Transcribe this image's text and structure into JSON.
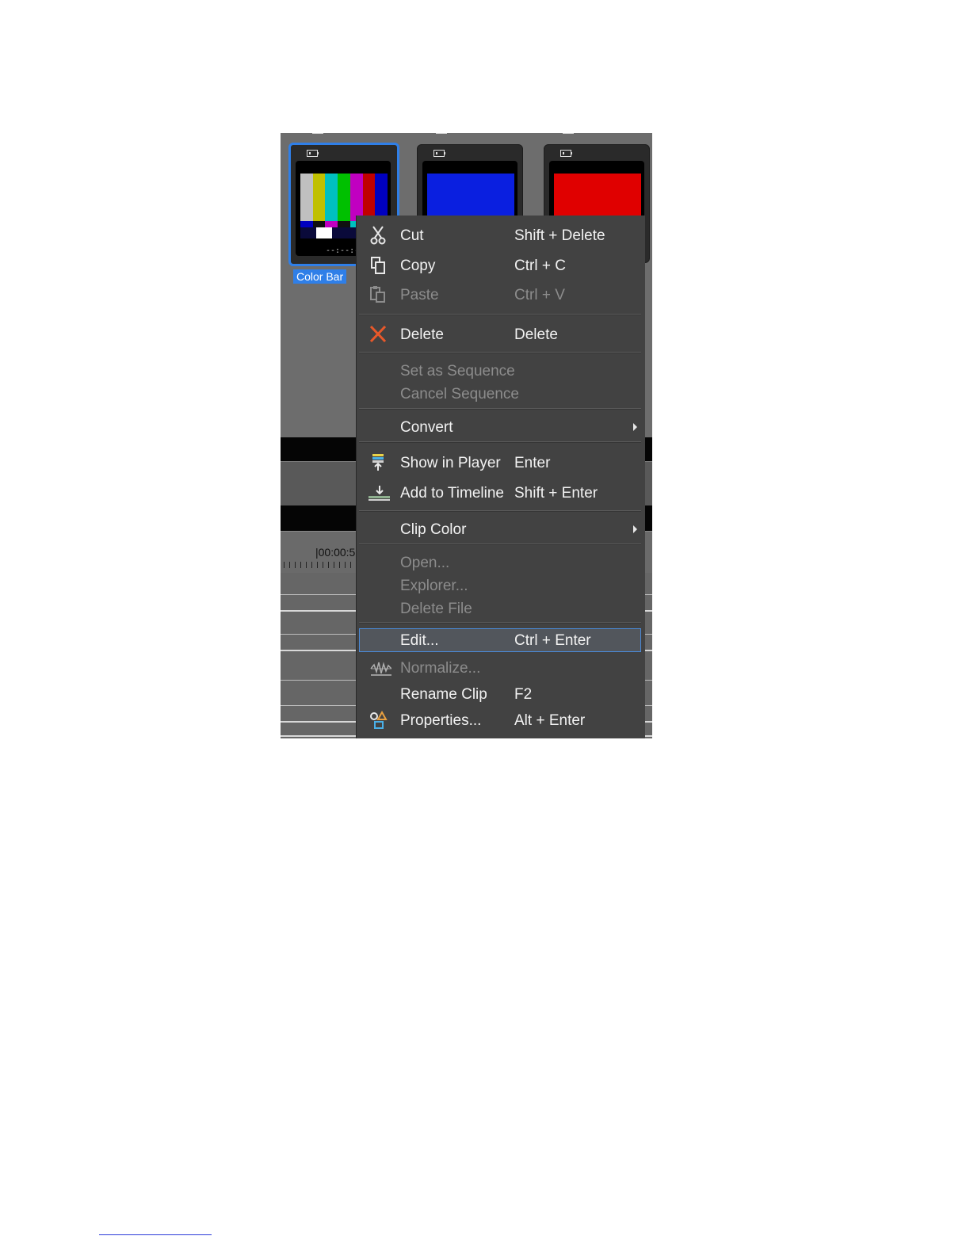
{
  "bin": {
    "clips": [
      {
        "name": "Color Bar",
        "timecode": "--:--:--;--",
        "selected": true
      },
      {
        "name": "",
        "color": "#0a1fe0"
      },
      {
        "name": "",
        "color": "#e00000"
      }
    ]
  },
  "colorbars": {
    "top": [
      "#c0c0c0",
      "#c0c000",
      "#00c0c0",
      "#00c000",
      "#c000c0",
      "#c00000",
      "#0000c0"
    ],
    "mid": [
      "#0000c0",
      "#101010",
      "#c000c0",
      "#101010",
      "#00c0c0",
      "#101010",
      "#c0c0c0"
    ]
  },
  "timeline": {
    "ruler_text": "|00:00:5"
  },
  "menu": {
    "cut": {
      "label": "Cut",
      "shortcut": "Shift + Delete"
    },
    "copy": {
      "label": "Copy",
      "shortcut": "Ctrl + C"
    },
    "paste": {
      "label": "Paste",
      "shortcut": "Ctrl + V"
    },
    "delete": {
      "label": "Delete",
      "shortcut": "Delete"
    },
    "set_as_sequence": {
      "label": "Set as Sequence"
    },
    "cancel_sequence": {
      "label": "Cancel Sequence"
    },
    "convert": {
      "label": "Convert"
    },
    "show_in_player": {
      "label": "Show in Player",
      "shortcut": "Enter"
    },
    "add_to_timeline": {
      "label": "Add to Timeline",
      "shortcut": "Shift + Enter"
    },
    "clip_color": {
      "label": "Clip Color"
    },
    "open": {
      "label": "Open..."
    },
    "explorer": {
      "label": "Explorer..."
    },
    "delete_file": {
      "label": "Delete File"
    },
    "edit": {
      "label": "Edit...",
      "shortcut": "Ctrl + Enter"
    },
    "normalize": {
      "label": "Normalize..."
    },
    "rename_clip": {
      "label": "Rename Clip",
      "shortcut": "F2"
    },
    "properties": {
      "label": "Properties...",
      "shortcut": "Alt + Enter"
    }
  },
  "colors": {
    "selection": "#2f7fe8",
    "menu_bg": "#424242",
    "delete_icon": "#e8582a"
  }
}
